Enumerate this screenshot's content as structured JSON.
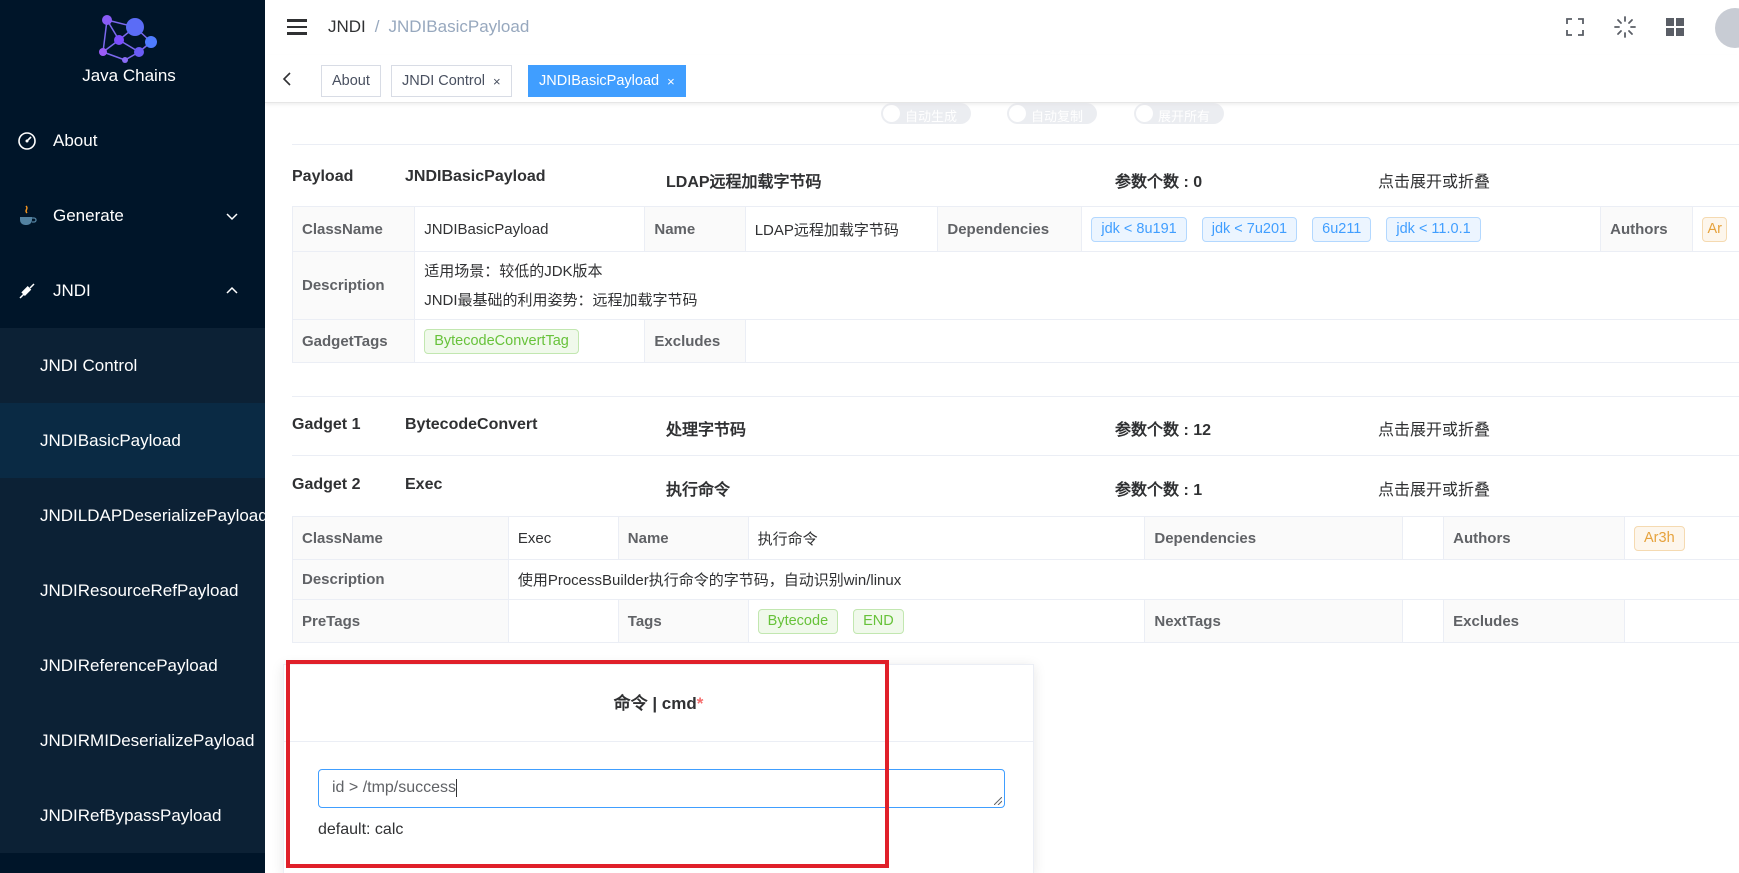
{
  "app": {
    "name": "Java Chains"
  },
  "sidebar": {
    "about": "About",
    "generate": "Generate",
    "jndi": "JNDI",
    "jndi_items": [
      "JNDI Control",
      "JNDIBasicPayload",
      "JNDILDAPDeserializePayload",
      "JNDIResourceRefPayload",
      "JNDIReferencePayload",
      "JNDIRMIDeserializePayload",
      "JNDIRefBypassPayload"
    ]
  },
  "breadcrumb": {
    "parent": "JNDI",
    "sep": "/",
    "current": "JNDIBasicPayload"
  },
  "tabs": [
    "About",
    "JNDI Control",
    "JNDIBasicPayload"
  ],
  "tab_close": "×",
  "toggles": [
    "自动生成",
    "自动复制",
    "展开所有"
  ],
  "payload": {
    "label": "Payload",
    "name": "JNDIBasicPayload",
    "title": "LDAP远程加载字节码",
    "param_count": "参数个数 : 0",
    "toggle_hint": "点击展开或折叠",
    "table": {
      "classname_label": "ClassName",
      "classname": "JNDIBasicPayload",
      "name_label": "Name",
      "name": "LDAP远程加载字节码",
      "deps_label": "Dependencies",
      "deps": [
        "jdk < 8u191",
        "jdk < 7u201",
        "6u211",
        "jdk < 11.0.1"
      ],
      "authors_label": "Authors",
      "author_partial": "Ar",
      "desc_label": "Description",
      "desc_line1": "适用场景：较低的JDK版本",
      "desc_line2": "JNDI最基础的利用姿势：远程加载字节码",
      "gadgettags_label": "GadgetTags",
      "gadgettag": "BytecodeConvertTag",
      "excludes_label": "Excludes"
    }
  },
  "gadget1": {
    "label": "Gadget 1",
    "name": "BytecodeConvert",
    "title": "处理字节码",
    "param_count": "参数个数 : 12",
    "toggle_hint": "点击展开或折叠"
  },
  "gadget2": {
    "label": "Gadget 2",
    "name": "Exec",
    "title": "执行命令",
    "param_count": "参数个数 : 1",
    "toggle_hint": "点击展开或折叠",
    "table": {
      "classname_label": "ClassName",
      "classname": "Exec",
      "name_label": "Name",
      "name": "执行命令",
      "deps_label": "Dependencies",
      "authors_label": "Authors",
      "author": "Ar3h",
      "desc_label": "Description",
      "desc": "使用ProcessBuilder执行命令的字节码，自动识别win/linux",
      "pretags_label": "PreTags",
      "tags_label": "Tags",
      "tags": [
        "Bytecode",
        "END"
      ],
      "nexttags_label": "NextTags",
      "excludes_label": "Excludes"
    }
  },
  "param_card": {
    "title": "命令 | cmd",
    "required": "*",
    "value": "id > /tmp/success",
    "default": "default: calc"
  },
  "colors": {
    "sidebar": "#001529",
    "accent": "#409eff",
    "highlight": "#e0202a"
  }
}
